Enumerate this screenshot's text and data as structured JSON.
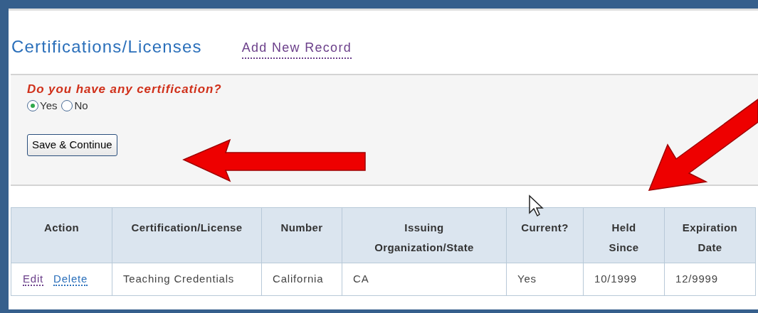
{
  "heading": {
    "title": "Certifications/Licenses",
    "add_link": "Add New Record"
  },
  "form": {
    "question": "Do you have any certification?",
    "options": [
      {
        "label": "Yes",
        "selected": true
      },
      {
        "label": "No",
        "selected": false
      }
    ],
    "save_button": "Save & Continue"
  },
  "table": {
    "columns": [
      "Action",
      "Certification/License",
      "Number",
      "Issuing Organization/State",
      "Current?",
      "Held Since",
      "Expiration Date"
    ],
    "rows": [
      {
        "cells": [
          [
            "Edit",
            "Delete"
          ],
          "Teaching Credentials",
          "California",
          "CA",
          "Yes",
          "10/1999",
          "12/9999"
        ]
      }
    ]
  }
}
